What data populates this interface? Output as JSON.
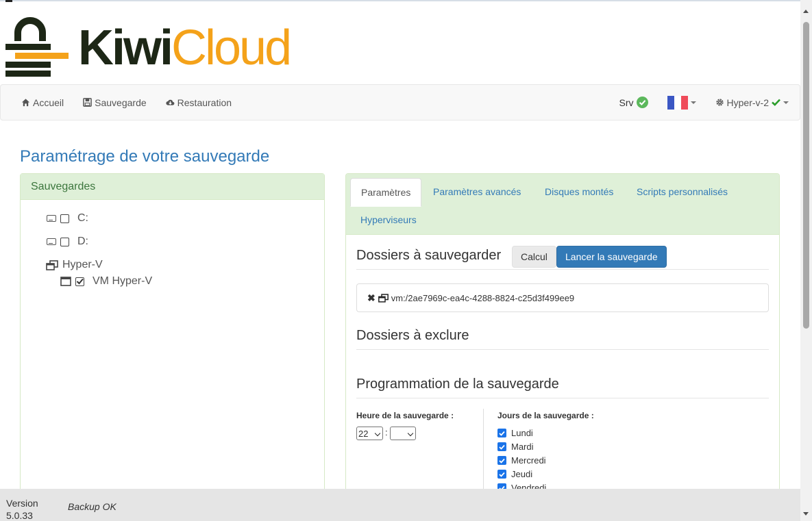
{
  "logo": {
    "part1": "Kiwi",
    "part2": "Cloud"
  },
  "nav": {
    "items": [
      {
        "label": "Accueil",
        "icon": "home-icon"
      },
      {
        "label": "Sauvegarde",
        "icon": "save-icon"
      },
      {
        "label": "Restauration",
        "icon": "cloud-download-icon"
      }
    ],
    "srv_label": "Srv",
    "language_icon": "flag-fr-icon",
    "host_label": "Hyper-v-2",
    "colors": {
      "ok": "#5cb85c",
      "link": "#337ab7"
    }
  },
  "page_title": "Paramétrage de votre sauvegarde",
  "left_panel": {
    "title": "Sauvegardes",
    "tree": [
      {
        "label": "C:",
        "icon": "hard-drive-icon",
        "checked": false
      },
      {
        "label": "D:",
        "icon": "hard-drive-icon",
        "checked": false
      },
      {
        "label": "Hyper-V",
        "icon": "clone-icon"
      },
      {
        "label": "VM Hyper-V",
        "icon": "window-icon",
        "checked": true
      }
    ]
  },
  "right_panel": {
    "tabs": [
      "Paramètres",
      "Paramètres avancés",
      "Disques montés",
      "Scripts personnalisés",
      "Hyperviseurs"
    ],
    "active_tab": "Paramètres",
    "folders_heading": "Dossiers à sauvegarder",
    "calc_button": "Calcul",
    "launch_button": "Lancer la sauvegarde",
    "folder_path": "vm:/2ae7969c-ea4c-4288-8824-c25d3f499ee9",
    "exclude_heading": "Dossiers à exclure",
    "schedule_heading": "Programmation de la sauvegarde",
    "time_label": "Heure de la sauvegarde :",
    "hour_value": "22",
    "time_sep": ":",
    "minute_value": "",
    "days_label": "Jours de la sauvegarde :",
    "days": [
      {
        "label": "Lundi",
        "checked": true
      },
      {
        "label": "Mardi",
        "checked": true
      },
      {
        "label": "Mercredi",
        "checked": true
      },
      {
        "label": "Jeudi",
        "checked": true
      },
      {
        "label": "Vendredi",
        "checked": true
      }
    ]
  },
  "footer": {
    "version_label": "Version",
    "version_number": "5.0.33",
    "status": "Backup OK"
  }
}
